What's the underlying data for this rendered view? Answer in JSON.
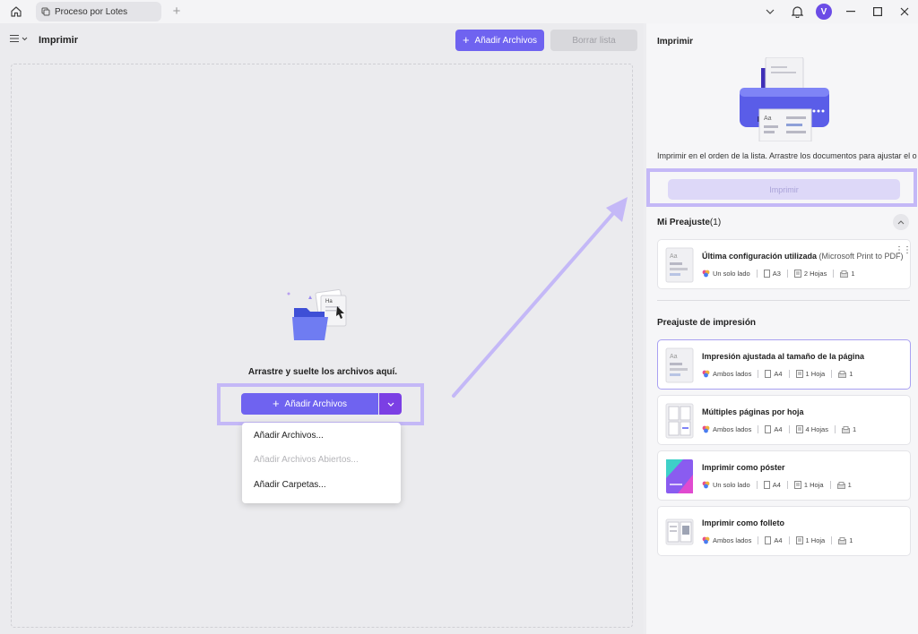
{
  "titlebar": {
    "tab_label": "Proceso por Lotes",
    "avatar_letter": "V"
  },
  "left": {
    "title": "Imprimir",
    "add_files_label": "Añadir Archivos",
    "clear_list_label": "Borrar lista",
    "drop_text": "Arrastre y suelte los archivos aquí.",
    "main_add_label": "Añadir Archivos",
    "dropdown_items": [
      "Añadir Archivos...",
      "Añadir Archivos Abiertos...",
      "Añadir Carpetas..."
    ]
  },
  "right": {
    "title": "Imprimir",
    "description": "Imprimir en el orden de la lista. Arrastre los documentos para ajustar el orden.",
    "print_button": "Imprimir",
    "my_presets_title": "Mi Preajuste",
    "my_presets_count": "(1)",
    "print_presets_title": "Preajuste de impresión",
    "my_presets": [
      {
        "name": "Última configuración utilizada",
        "printer": "(Microsoft Print to PDF)",
        "sides": "Un solo lado",
        "paper": "A3",
        "sheets": "2 Hojas",
        "copies": "1"
      }
    ],
    "presets": [
      {
        "name": "Impresión ajustada al tamaño de la página",
        "sides": "Ambos lados",
        "paper": "A4",
        "sheets": "1 Hoja",
        "copies": "1"
      },
      {
        "name": "Múltiples páginas por hoja",
        "sides": "Ambos lados",
        "paper": "A4",
        "sheets": "4 Hojas",
        "copies": "1"
      },
      {
        "name": "Imprimir como póster",
        "sides": "Un solo lado",
        "paper": "A4",
        "sheets": "1 Hoja",
        "copies": "1"
      },
      {
        "name": "Imprimir como folleto",
        "sides": "Ambos lados",
        "paper": "A4",
        "sheets": "1 Hoja",
        "copies": "1"
      }
    ]
  },
  "colors": {
    "accent": "#6f63f0",
    "accent_dark": "#7b3fe4",
    "highlight": "#c4b8f7"
  }
}
